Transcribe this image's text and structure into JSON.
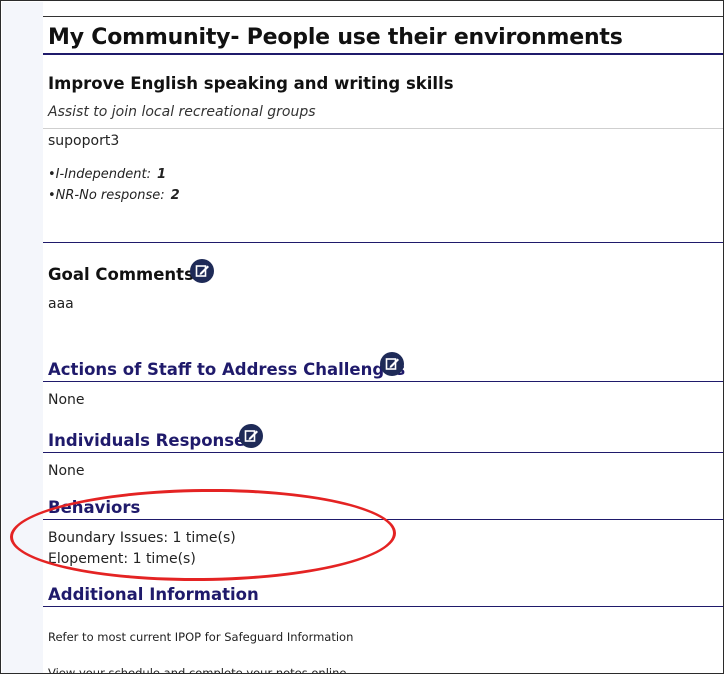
{
  "page_title": "My Community- People use their environments",
  "goal": {
    "title": "Improve English speaking and writing skills",
    "subtitle": "Assist to join local recreational groups",
    "support_label": "supoport3",
    "scores": [
      {
        "label": "•I-Independent:",
        "value": "1"
      },
      {
        "label": "•NR-No response:",
        "value": "2"
      }
    ]
  },
  "goal_comments": {
    "heading": "Goal Comments",
    "text": "aaa"
  },
  "staff_actions": {
    "heading": "Actions of Staff to Address Challenges",
    "text": "None"
  },
  "individuals_response": {
    "heading": "Individuals Response",
    "text": "None"
  },
  "behaviors": {
    "heading": "Behaviors",
    "items": [
      "Boundary Issues: 1 time(s)",
      "Elopement: 1 time(s)"
    ]
  },
  "additional_info": {
    "heading": "Additional Information",
    "line1": "Refer to most current IPOP for Safeguard Information",
    "line2": "View your schedule and complete your notes online"
  },
  "colors": {
    "heading_navy": "#1f1a6b",
    "icon_navy": "#1e2a57",
    "highlight_red": "#e42323"
  }
}
